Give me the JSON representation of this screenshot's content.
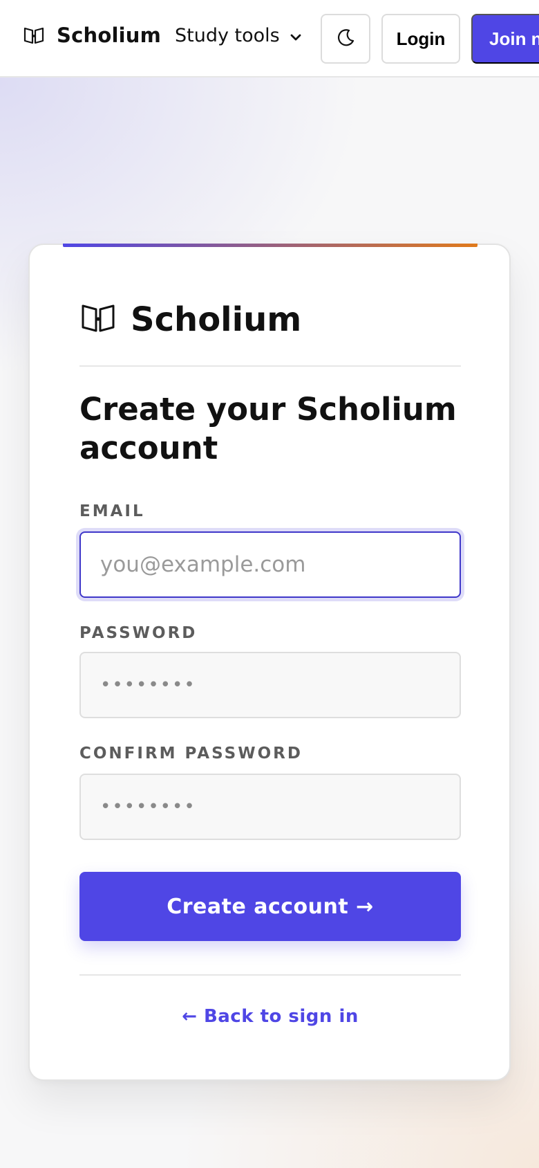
{
  "header": {
    "brand_name": "Scholium",
    "brand_icon": "open-book-icon",
    "nav_tools_label": "Study tools",
    "nav_tools_icon": "chevron-down-icon",
    "theme_toggle_icon": "moon-icon",
    "login_label": "Login",
    "join_label": "Join n"
  },
  "card": {
    "brand_name": "Scholium",
    "brand_icon": "open-book-icon",
    "title": "Create your Scholium account",
    "email": {
      "label": "EMAIL",
      "placeholder": "you@example.com",
      "value": ""
    },
    "password": {
      "label": "PASSWORD",
      "value": "••••••••"
    },
    "confirm_password": {
      "label": "CONFIRM PASSWORD",
      "value": "••••••••"
    },
    "submit_label": "Create account →",
    "back_link_label": "← Back to sign in"
  },
  "colors": {
    "accent": "#4f46e5",
    "accent_gradient_end": "#e07a1c",
    "page_background": "#f7f7f8"
  }
}
